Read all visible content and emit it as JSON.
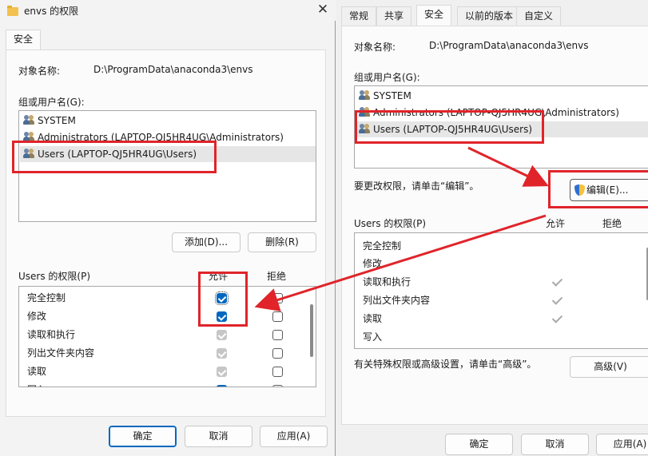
{
  "left": {
    "title": "envs 的权限",
    "close": "✕",
    "tab": "安全",
    "object_label": "对象名称:",
    "object_value": "D:\\ProgramData\\anaconda3\\envs",
    "group_label": "组或用户名(G):",
    "users": [
      {
        "name": "SYSTEM"
      },
      {
        "name": "Administrators (LAPTOP-QJ5HR4UG\\Administrators)"
      },
      {
        "name": "Users (LAPTOP-QJ5HR4UG\\Users)"
      }
    ],
    "add_button": "添加(D)...",
    "remove_button": "删除(R)",
    "perm_label": "Users 的权限(P)",
    "allow_header": "允许",
    "deny_header": "拒绝",
    "permissions": [
      {
        "name": "完全控制",
        "allow": "checked",
        "deny": "unchecked"
      },
      {
        "name": "修改",
        "allow": "checked",
        "deny": "unchecked"
      },
      {
        "name": "读取和执行",
        "allow": "inherited",
        "deny": "unchecked"
      },
      {
        "name": "列出文件夹内容",
        "allow": "inherited",
        "deny": "unchecked"
      },
      {
        "name": "读取",
        "allow": "inherited",
        "deny": "unchecked"
      },
      {
        "name": "写入",
        "allow": "checked",
        "deny": "unchecked"
      }
    ],
    "ok_button": "确定",
    "cancel_button": "取消",
    "apply_button": "应用(A)"
  },
  "right": {
    "tabs": [
      "常规",
      "共享",
      "安全",
      "以前的版本",
      "自定义"
    ],
    "active_tab": "安全",
    "object_label": "对象名称:",
    "object_value": "D:\\ProgramData\\anaconda3\\envs",
    "group_label": "组或用户名(G):",
    "users": [
      {
        "name": "SYSTEM"
      },
      {
        "name": "Administrators (LAPTOP-QJ5HR4UG\\Administrators)"
      },
      {
        "name": "Users (LAPTOP-QJ5HR4UG\\Users)"
      }
    ],
    "edit_hint": "要更改权限，请单击“编辑”。",
    "edit_button": "编辑(E)...",
    "perm_label": "Users 的权限(P)",
    "allow_header": "允许",
    "deny_header": "拒绝",
    "permissions": [
      {
        "name": "完全控制",
        "allow": false
      },
      {
        "name": "修改",
        "allow": false
      },
      {
        "name": "读取和执行",
        "allow": true
      },
      {
        "name": "列出文件夹内容",
        "allow": true
      },
      {
        "name": "读取",
        "allow": true
      },
      {
        "name": "写入",
        "allow": false
      }
    ],
    "advanced_hint": "有关特殊权限或高级设置，请单击“高级”。",
    "advanced_button": "高级(V)",
    "ok_button": "确定",
    "cancel_button": "取消",
    "apply_button": "应用(A)"
  },
  "colors": {
    "annotation_red": "#e0242a",
    "checkbox_blue": "#0067c0"
  }
}
